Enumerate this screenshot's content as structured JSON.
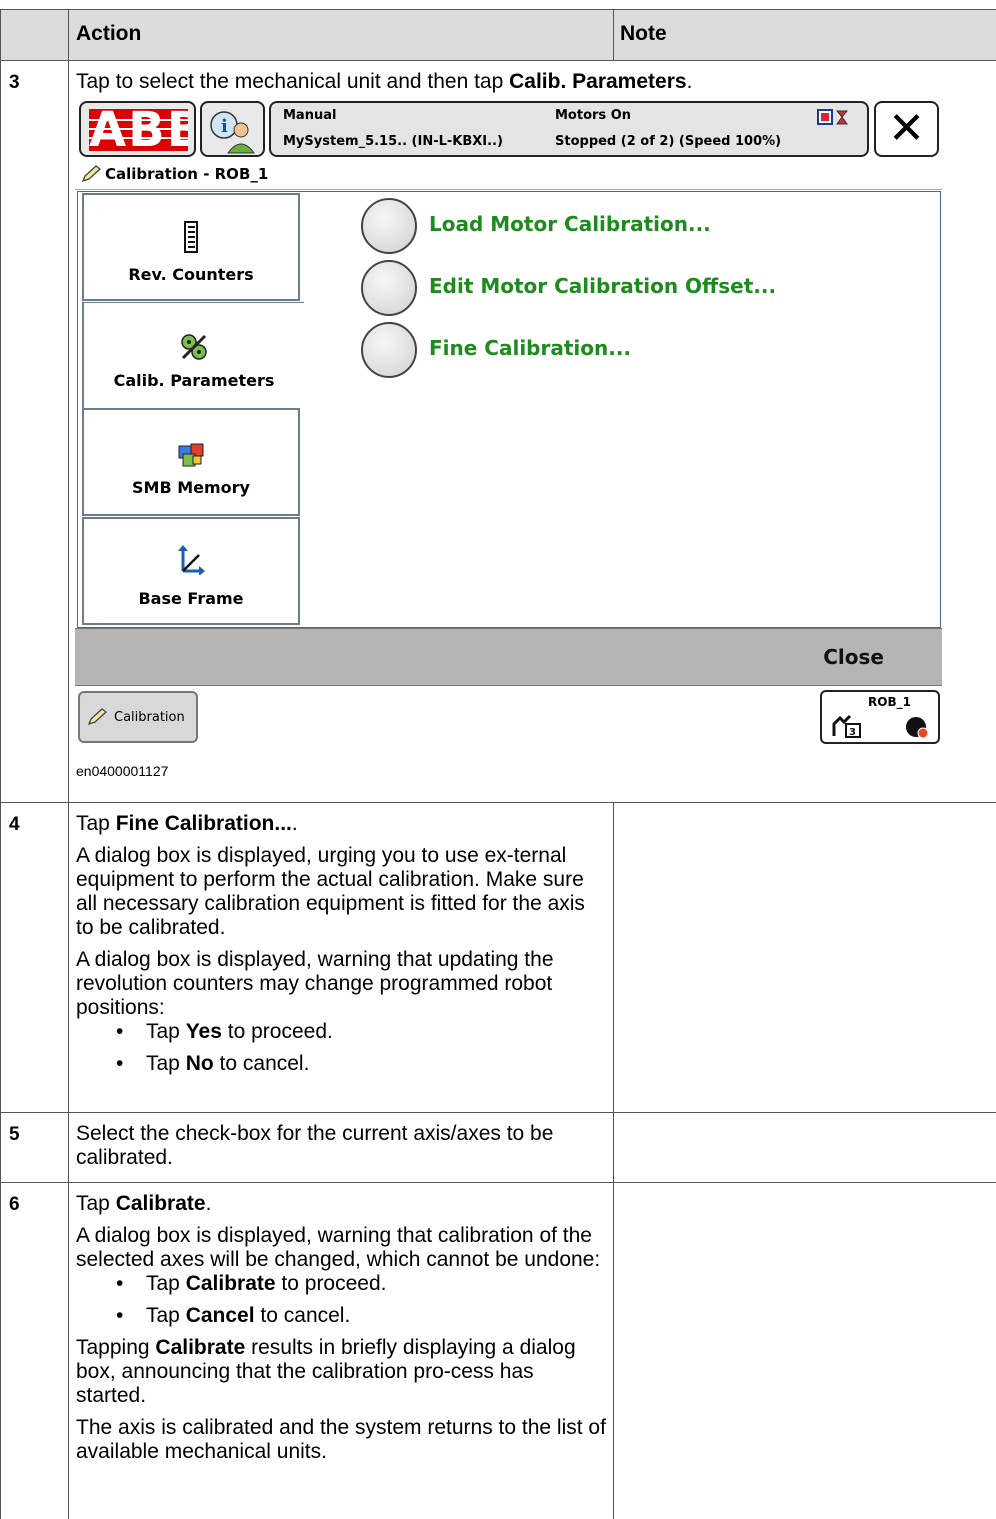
{
  "table": {
    "headers": {
      "action": "Action",
      "note": "Note"
    }
  },
  "steps": {
    "s3": {
      "number": "3",
      "text_pre": "Tap to select the mechanical unit and then tap ",
      "text_bold": "Calib. Parameters",
      "text_post": ".",
      "figure_caption": "en0400001127"
    },
    "s4": {
      "number": "4",
      "p1_pre": "Tap ",
      "p1_bold": "Fine Calibration...",
      "p1_post": ".",
      "p2": "A dialog box is displayed, urging you to use ex-ternal equipment to perform the actual calibration. Make sure all necessary calibration equipment is fitted for the axis to be calibrated.",
      "p3": "A dialog box is displayed, warning that updating the revolution counters may change programmed robot positions:",
      "b1_pre": "Tap ",
      "b1_bold": "Yes",
      "b1_post": " to proceed.",
      "b2_pre": "Tap ",
      "b2_bold": "No",
      "b2_post": " to cancel."
    },
    "s5": {
      "number": "5",
      "text": "Select the check-box for the current axis/axes to be calibrated."
    },
    "s6": {
      "number": "6",
      "p1_pre": "Tap ",
      "p1_bold": "Calibrate",
      "p1_post": ".",
      "p2": "A dialog box is displayed, warning that calibration of the selected axes will be changed, which cannot be undone:",
      "b1_pre": "Tap ",
      "b1_bold": "Calibrate",
      "b1_post": " to proceed.",
      "b2_pre": "Tap ",
      "b2_bold": "Cancel",
      "b2_post": " to cancel.",
      "p3_pre": "Tapping ",
      "p3_bold": "Calibrate",
      "p3_post": " results in briefly displaying a dialog box, announcing that the calibration pro-cess has started.",
      "p4": "The axis is calibrated and the system returns to the list of available mechanical units."
    }
  },
  "flexpendant": {
    "logo": "ABB",
    "status": {
      "mode": "Manual",
      "system": "MySystem_5.15.. (IN-L-KBXI..)",
      "motors": "Motors On",
      "state": "Stopped (2 of 2) (Speed 100%)"
    },
    "close_glyph": "✕",
    "window_title": "Calibration - ROB_1",
    "side_tabs": [
      {
        "label": "Rev. Counters",
        "icon": "ruler-icon"
      },
      {
        "label": "Calib. Parameters",
        "icon": "calib-parameters-icon"
      },
      {
        "label": "SMB Memory",
        "icon": "smb-memory-icon"
      },
      {
        "label": "Base Frame",
        "icon": "base-frame-icon"
      }
    ],
    "options": [
      "Load Motor Calibration...",
      "Edit Motor Calibration Offset...",
      "Fine Calibration..."
    ],
    "command_bar": {
      "close_label": "Close"
    },
    "taskbar": {
      "task_label": "Calibration",
      "unit_label": "ROB_1"
    },
    "colors": {
      "option_text": "#1f8a1f",
      "abb_red": "#e00000",
      "command_bar": "#b5b5b5"
    }
  }
}
